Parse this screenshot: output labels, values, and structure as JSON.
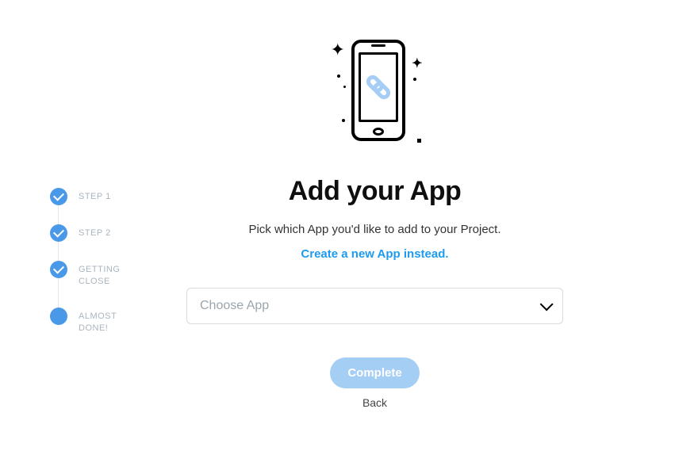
{
  "stepper": {
    "steps": [
      {
        "label": "STEP 1",
        "done": true
      },
      {
        "label": "STEP 2",
        "done": true
      },
      {
        "label": "GETTING CLOSE",
        "done": true
      },
      {
        "label": "ALMOST DONE!",
        "done": false
      }
    ]
  },
  "main": {
    "heading": "Add your App",
    "subtext": "Pick which App you'd like to add to your Project.",
    "create_link": "Create a new App instead.",
    "select_placeholder": "Choose App",
    "complete_label": "Complete",
    "back_label": "Back"
  }
}
